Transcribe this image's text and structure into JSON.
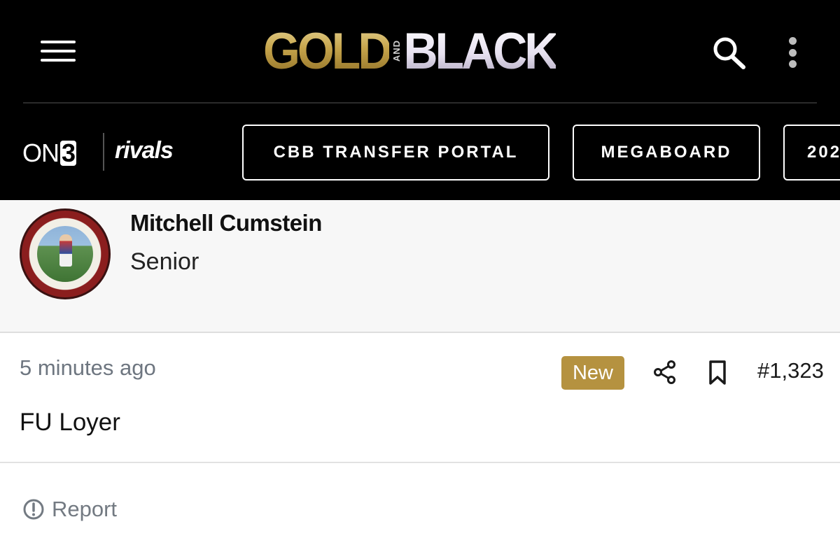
{
  "header": {
    "logo": {
      "gold_text": "GOLD",
      "and_text": "AND",
      "black_text": "BLACK"
    },
    "menu_icon": "hamburger-menu-icon",
    "search_icon": "search-icon",
    "more_icon": "vertical-dots-icon"
  },
  "subnav": {
    "on3_prefix": "ON",
    "on3_suffix": "3",
    "rivals_label": "rivals",
    "pills": [
      {
        "label": "CBB TRANSFER PORTAL"
      },
      {
        "label": "MEGABOARD"
      },
      {
        "label": "202"
      }
    ]
  },
  "post": {
    "author": {
      "name": "Mitchell Cumstein",
      "rank": "Senior",
      "avatar_text": "MITCH CUMSTEIN'S PUTTING ACADEMY"
    },
    "time_ago": "5 minutes ago",
    "badge": "New",
    "post_number": "#1,323",
    "body": "FU Loyer",
    "report_label": "Report"
  },
  "colors": {
    "header_bg": "#000000",
    "gold_accent": "#b59240",
    "meta_text": "#6e7680",
    "author_bg": "#f7f7f7"
  }
}
